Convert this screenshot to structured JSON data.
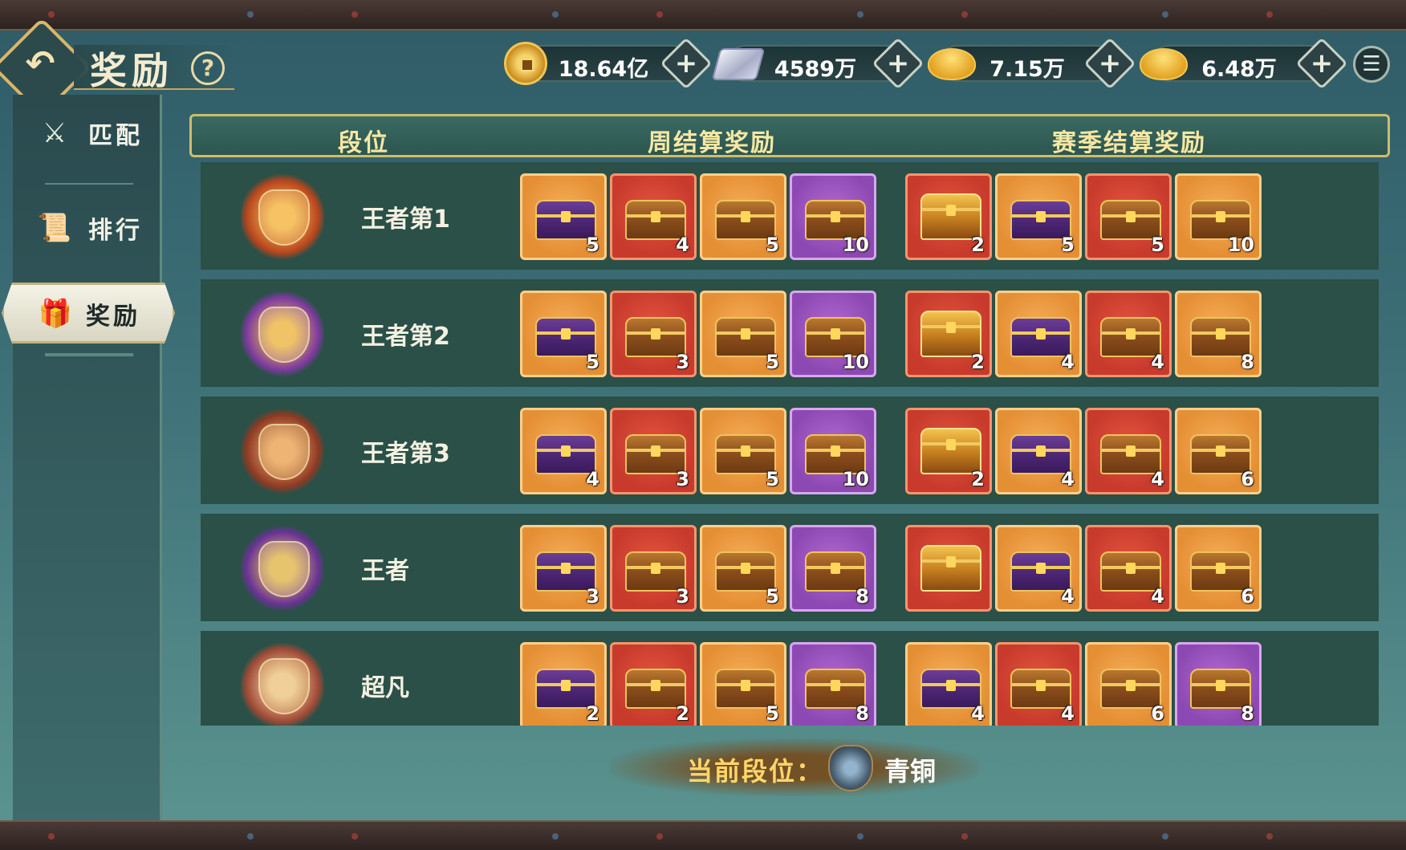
{
  "header": {
    "title": "奖励",
    "help_label": "?",
    "back_icon": "back-arrow-icon",
    "menu_icon": "list-menu-icon"
  },
  "currencies": [
    {
      "icon": "copper-coin-icon",
      "value": "18.64亿"
    },
    {
      "icon": "silver-ingot-icon",
      "value": "4589万"
    },
    {
      "icon": "locked-gold-ingot-icon",
      "value": "7.15万"
    },
    {
      "icon": "gold-ingot-icon",
      "value": "6.48万"
    }
  ],
  "sidebar": {
    "items": [
      {
        "label": "匹配",
        "icon": "crossed-swords-icon",
        "active": false
      },
      {
        "label": "排行",
        "icon": "scroll-icon",
        "active": false
      },
      {
        "label": "奖励",
        "icon": "gift-icon",
        "active": true
      }
    ]
  },
  "table": {
    "headers": {
      "rank": "段位",
      "weekly": "周结算奖励",
      "season": "赛季结算奖励"
    },
    "rows": [
      {
        "rank": "王者第1",
        "weekly": [
          {
            "color": "orange",
            "type": "purple-chest",
            "count": "5"
          },
          {
            "color": "red",
            "type": "bronze-chest",
            "count": "4"
          },
          {
            "color": "orange",
            "type": "bronze-chest",
            "count": "5"
          },
          {
            "color": "purple",
            "type": "bronze-chest",
            "count": "10"
          }
        ],
        "season": [
          {
            "color": "red",
            "type": "grand-chest",
            "count": "2"
          },
          {
            "color": "orange",
            "type": "purple-chest",
            "count": "5"
          },
          {
            "color": "red",
            "type": "bronze-chest",
            "count": "5"
          },
          {
            "color": "orange",
            "type": "bronze-chest",
            "count": "10"
          }
        ]
      },
      {
        "rank": "王者第2",
        "weekly": [
          {
            "color": "orange",
            "type": "purple-chest",
            "count": "5"
          },
          {
            "color": "red",
            "type": "bronze-chest",
            "count": "3"
          },
          {
            "color": "orange",
            "type": "bronze-chest",
            "count": "5"
          },
          {
            "color": "purple",
            "type": "bronze-chest",
            "count": "10"
          }
        ],
        "season": [
          {
            "color": "red",
            "type": "grand-chest",
            "count": "2"
          },
          {
            "color": "orange",
            "type": "purple-chest",
            "count": "4"
          },
          {
            "color": "red",
            "type": "bronze-chest",
            "count": "4"
          },
          {
            "color": "orange",
            "type": "bronze-chest",
            "count": "8"
          }
        ]
      },
      {
        "rank": "王者第3",
        "weekly": [
          {
            "color": "orange",
            "type": "purple-chest",
            "count": "4"
          },
          {
            "color": "red",
            "type": "bronze-chest",
            "count": "3"
          },
          {
            "color": "orange",
            "type": "bronze-chest",
            "count": "5"
          },
          {
            "color": "purple",
            "type": "bronze-chest",
            "count": "10"
          }
        ],
        "season": [
          {
            "color": "red",
            "type": "grand-chest",
            "count": "2"
          },
          {
            "color": "orange",
            "type": "purple-chest",
            "count": "4"
          },
          {
            "color": "red",
            "type": "bronze-chest",
            "count": "4"
          },
          {
            "color": "orange",
            "type": "bronze-chest",
            "count": "6"
          }
        ]
      },
      {
        "rank": "王者",
        "weekly": [
          {
            "color": "orange",
            "type": "purple-chest",
            "count": "3"
          },
          {
            "color": "red",
            "type": "bronze-chest",
            "count": "3"
          },
          {
            "color": "orange",
            "type": "bronze-chest",
            "count": "5"
          },
          {
            "color": "purple",
            "type": "bronze-chest",
            "count": "8"
          }
        ],
        "season": [
          {
            "color": "red",
            "type": "grand-chest",
            "count": ""
          },
          {
            "color": "orange",
            "type": "purple-chest",
            "count": "4"
          },
          {
            "color": "red",
            "type": "bronze-chest",
            "count": "4"
          },
          {
            "color": "orange",
            "type": "bronze-chest",
            "count": "6"
          }
        ]
      },
      {
        "rank": "超凡",
        "weekly": [
          {
            "color": "orange",
            "type": "purple-chest",
            "count": "2"
          },
          {
            "color": "red",
            "type": "bronze-chest",
            "count": "2"
          },
          {
            "color": "orange",
            "type": "bronze-chest",
            "count": "5"
          },
          {
            "color": "purple",
            "type": "bronze-chest",
            "count": "8"
          }
        ],
        "season": [
          {
            "color": "orange",
            "type": "purple-chest",
            "count": "4"
          },
          {
            "color": "red",
            "type": "bronze-chest",
            "count": "4"
          },
          {
            "color": "orange",
            "type": "bronze-chest",
            "count": "6"
          },
          {
            "color": "purple",
            "type": "bronze-chest",
            "count": "8"
          }
        ]
      }
    ]
  },
  "current_rank": {
    "label": "当前段位：",
    "value": "青铜"
  },
  "colors": {
    "gold_accent": "#f6e7a2",
    "row_bg": "#2a5047",
    "reward_orange": "#e58f35",
    "reward_red": "#c83a2c",
    "reward_purple": "#8d49b3"
  }
}
